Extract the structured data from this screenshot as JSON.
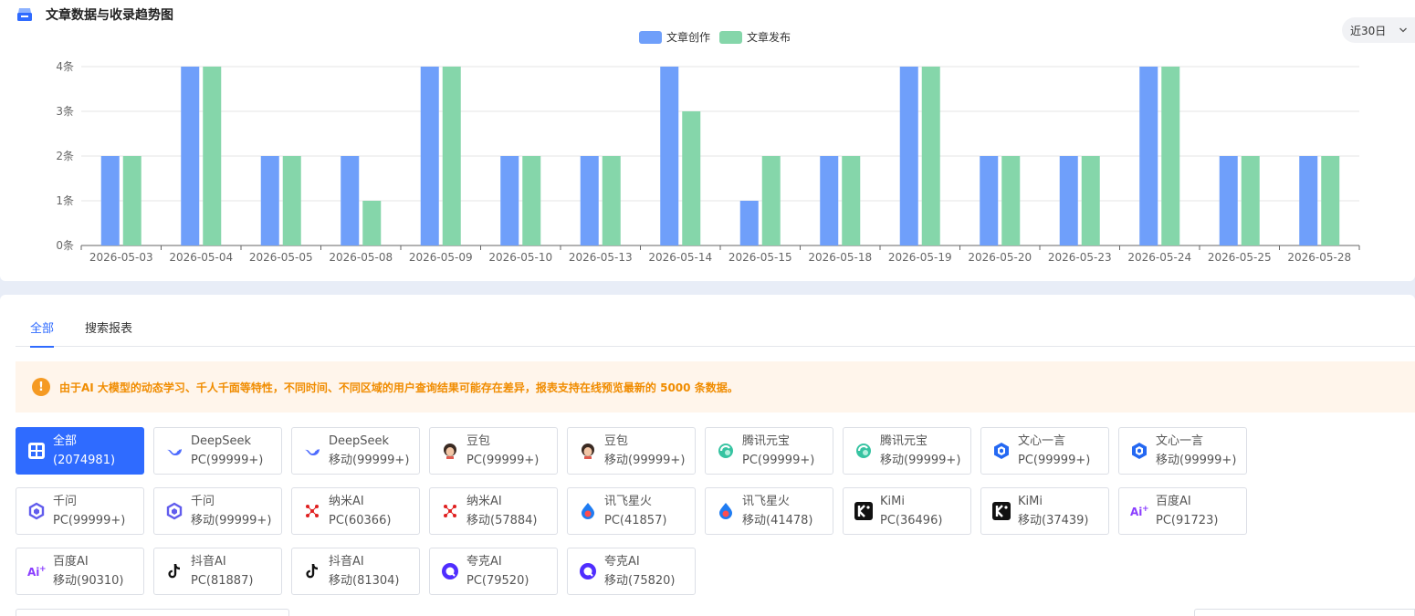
{
  "header": {
    "title": "文章数据与收录趋势图",
    "icon": "chart-card-icon"
  },
  "range_select": {
    "value": "近30日"
  },
  "colors": {
    "creation": "#6f9ffa",
    "publish": "#85d6aa",
    "accent": "#2f6bff",
    "warning": "#f59a23"
  },
  "chart_data": {
    "type": "bar",
    "categories": [
      "2026-05-03",
      "2026-05-04",
      "2026-05-05",
      "2026-05-08",
      "2026-05-09",
      "2026-05-10",
      "2026-05-13",
      "2026-05-14",
      "2026-05-15",
      "2026-05-18",
      "2026-05-19",
      "2026-05-20",
      "2026-05-23",
      "2026-05-24",
      "2026-05-25",
      "2026-05-28"
    ],
    "series": [
      {
        "name": "文章创作",
        "color": "#6f9ffa",
        "values": [
          2,
          4,
          2,
          2,
          4,
          2,
          2,
          4,
          1,
          2,
          4,
          2,
          2,
          4,
          2,
          2
        ]
      },
      {
        "name": "文章发布",
        "color": "#85d6aa",
        "values": [
          2,
          4,
          2,
          1,
          4,
          2,
          2,
          3,
          2,
          2,
          4,
          2,
          2,
          4,
          2,
          2
        ]
      }
    ],
    "yticks": [
      "0条",
      "1条",
      "2条",
      "3条",
      "4条"
    ],
    "ylim": [
      0,
      4
    ],
    "grid": true,
    "legend_position": "top-center"
  },
  "tabs": [
    {
      "label": "全部",
      "active": true
    },
    {
      "label": "搜索报表",
      "active": false
    }
  ],
  "notice": {
    "icon": "warning-icon",
    "text": "由于AI 大模型的动态学习、千人千面等特性，不同时间、不同区域的用户查询结果可能存在差异，报表支持在线预览最新的 5000 条数据。"
  },
  "engines": [
    {
      "name": "全部",
      "detail": "(2074981)",
      "icon": "grid-icon",
      "active": true
    },
    {
      "name": "DeepSeek",
      "detail": "PC(99999+)",
      "icon": "deepseek-icon"
    },
    {
      "name": "DeepSeek",
      "detail": "移动(99999+)",
      "icon": "deepseek-icon"
    },
    {
      "name": "豆包",
      "detail": "PC(99999+)",
      "icon": "doubao-icon"
    },
    {
      "name": "豆包",
      "detail": "移动(99999+)",
      "icon": "doubao-icon"
    },
    {
      "name": "腾讯元宝",
      "detail": "PC(99999+)",
      "icon": "yuanbao-icon"
    },
    {
      "name": "腾讯元宝",
      "detail": "移动(99999+)",
      "icon": "yuanbao-icon"
    },
    {
      "name": "文心一言",
      "detail": "PC(99999+)",
      "icon": "wenxin-icon"
    },
    {
      "name": "文心一言",
      "detail": "移动(99999+)",
      "icon": "wenxin-icon"
    },
    {
      "name": "千问",
      "detail": "PC(99999+)",
      "icon": "qianwen-icon"
    },
    {
      "name": "千问",
      "detail": "移动(99999+)",
      "icon": "qianwen-icon"
    },
    {
      "name": "纳米AI",
      "detail": "PC(60366)",
      "icon": "nami-icon"
    },
    {
      "name": "纳米AI",
      "detail": "移动(57884)",
      "icon": "nami-icon"
    },
    {
      "name": "讯飞星火",
      "detail": "PC(41857)",
      "icon": "xinghuo-icon"
    },
    {
      "name": "讯飞星火",
      "detail": "移动(41478)",
      "icon": "xinghuo-icon"
    },
    {
      "name": "KiMi",
      "detail": "PC(36496)",
      "icon": "kimi-icon"
    },
    {
      "name": "KiMi",
      "detail": "移动(37439)",
      "icon": "kimi-icon"
    },
    {
      "name": "百度AI",
      "detail": "PC(91723)",
      "icon": "baidu-ai-icon"
    },
    {
      "name": "百度AI",
      "detail": "移动(90310)",
      "icon": "baidu-ai-icon"
    },
    {
      "name": "抖音AI",
      "detail": "PC(81887)",
      "icon": "douyin-icon"
    },
    {
      "name": "抖音AI",
      "detail": "移动(81304)",
      "icon": "douyin-icon"
    },
    {
      "name": "夸克AI",
      "detail": "PC(79520)",
      "icon": "quark-icon"
    },
    {
      "name": "夸克AI",
      "detail": "移动(75820)",
      "icon": "quark-icon"
    }
  ]
}
